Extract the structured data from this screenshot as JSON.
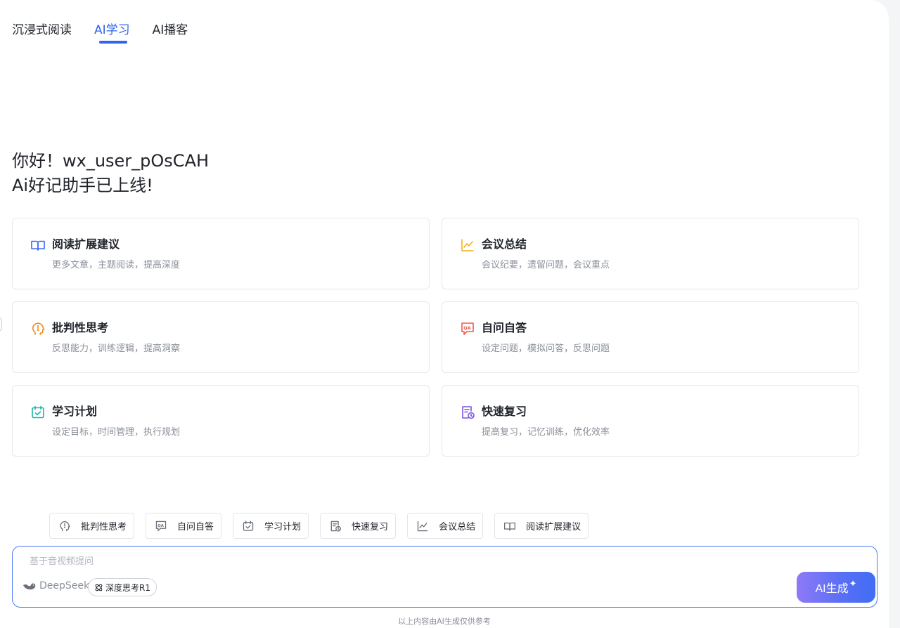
{
  "tabs": [
    {
      "label": "沉浸式阅读"
    },
    {
      "label": "AI学习"
    },
    {
      "label": "AI播客"
    }
  ],
  "greeting": {
    "line1": "你好！wx_user_pOsCAH",
    "line2": "Ai好记助手已上线!"
  },
  "cards": [
    {
      "title": "阅读扩展建议",
      "subtitle": "更多文章，主题阅读，提高深度",
      "icon": "book-icon",
      "color": "#3b6cf0"
    },
    {
      "title": "会议总结",
      "subtitle": "会议纪要，遗留问题，会议重点",
      "icon": "line-chart-icon",
      "color": "#f2b21b"
    },
    {
      "title": "批判性思考",
      "subtitle": "反思能力，训练逻辑，提高洞察",
      "icon": "head-exclaim-icon",
      "color": "#f28a1e"
    },
    {
      "title": "自问自答",
      "subtitle": "设定问题，模拟问答，反思问题",
      "icon": "qa-icon",
      "color": "#ef5a4a"
    },
    {
      "title": "学习计划",
      "subtitle": "设定目标，时间管理，执行规划",
      "icon": "calendar-check-icon",
      "color": "#1fb5a8"
    },
    {
      "title": "快速复习",
      "subtitle": "提高复习，记忆训练，优化效率",
      "icon": "doc-clock-icon",
      "color": "#7a52e0"
    }
  ],
  "chips": [
    {
      "label": "批判性思考",
      "icon": "head-exclaim-icon"
    },
    {
      "label": "自问自答",
      "icon": "qa-icon"
    },
    {
      "label": "学习计划",
      "icon": "calendar-check-icon"
    },
    {
      "label": "快速复习",
      "icon": "doc-clock-icon"
    },
    {
      "label": "会议总结",
      "icon": "line-chart-icon"
    },
    {
      "label": "阅读扩展建议",
      "icon": "book-icon"
    }
  ],
  "input": {
    "placeholder": "基于音视频提问",
    "value": ""
  },
  "model": {
    "name": "DeepSeek",
    "deep_think_label": "深度思考R1"
  },
  "generate_button": {
    "label": "AI生成",
    "spark": "✦"
  },
  "footnote": "以上内容由AI生成仅供参考",
  "colors": {
    "accent": "#2f64ec",
    "input_border": "#4b7bf0"
  }
}
